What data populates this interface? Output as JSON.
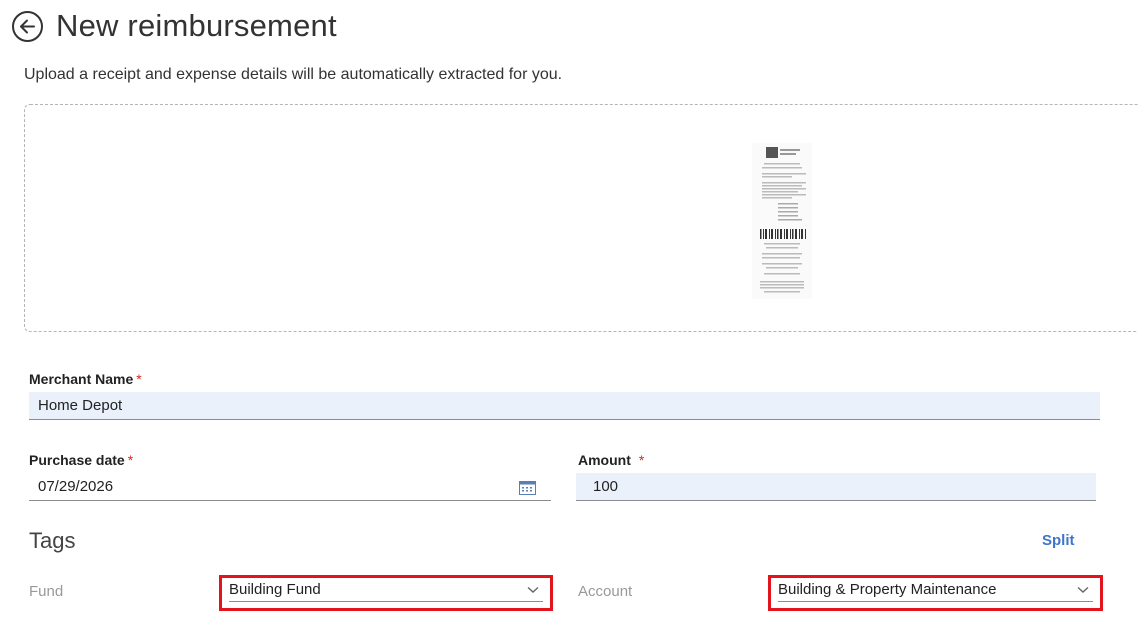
{
  "header": {
    "title": "New reimbursement",
    "back_icon": "arrow-left-circle-icon"
  },
  "upload": {
    "subtitle": "Upload a receipt and expense details will be automatically extracted for you."
  },
  "form": {
    "merchant": {
      "label": "Merchant Name",
      "required_mark": "*",
      "value": "Home Depot"
    },
    "purchase_date": {
      "label": "Purchase date",
      "required_mark": "*",
      "value": "07/29/2026",
      "icon": "calendar-icon"
    },
    "amount": {
      "label": "Amount",
      "required_mark": "*",
      "value": "100"
    }
  },
  "tags": {
    "title": "Tags",
    "split_label": "Split",
    "fund": {
      "label": "Fund",
      "value": "Building Fund"
    },
    "account": {
      "label": "Account",
      "value": "Building & Property Maintenance"
    }
  },
  "colors": {
    "highlight": "#e2141c",
    "link": "#3c76c9",
    "field_bg": "#eaf1fb",
    "required": "#d9261c"
  }
}
